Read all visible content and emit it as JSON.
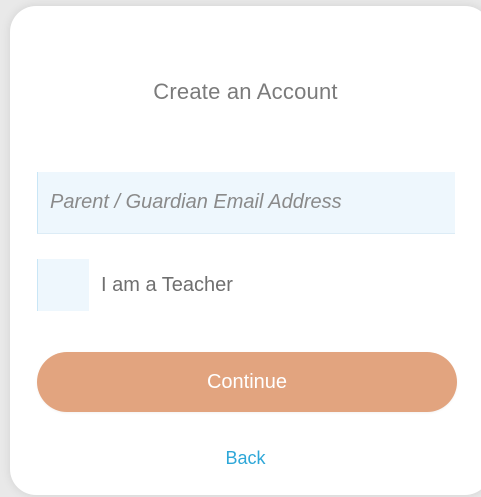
{
  "form": {
    "title": "Create an Account",
    "email_placeholder": "Parent / Guardian Email Address",
    "email_value": "",
    "teacher_label": "I am a Teacher",
    "teacher_checked": false,
    "continue_label": "Continue",
    "back_label": "Back"
  },
  "colors": {
    "accent": "#e2a47f",
    "link": "#2ea7d8",
    "input_bg": "#eef7fd"
  }
}
